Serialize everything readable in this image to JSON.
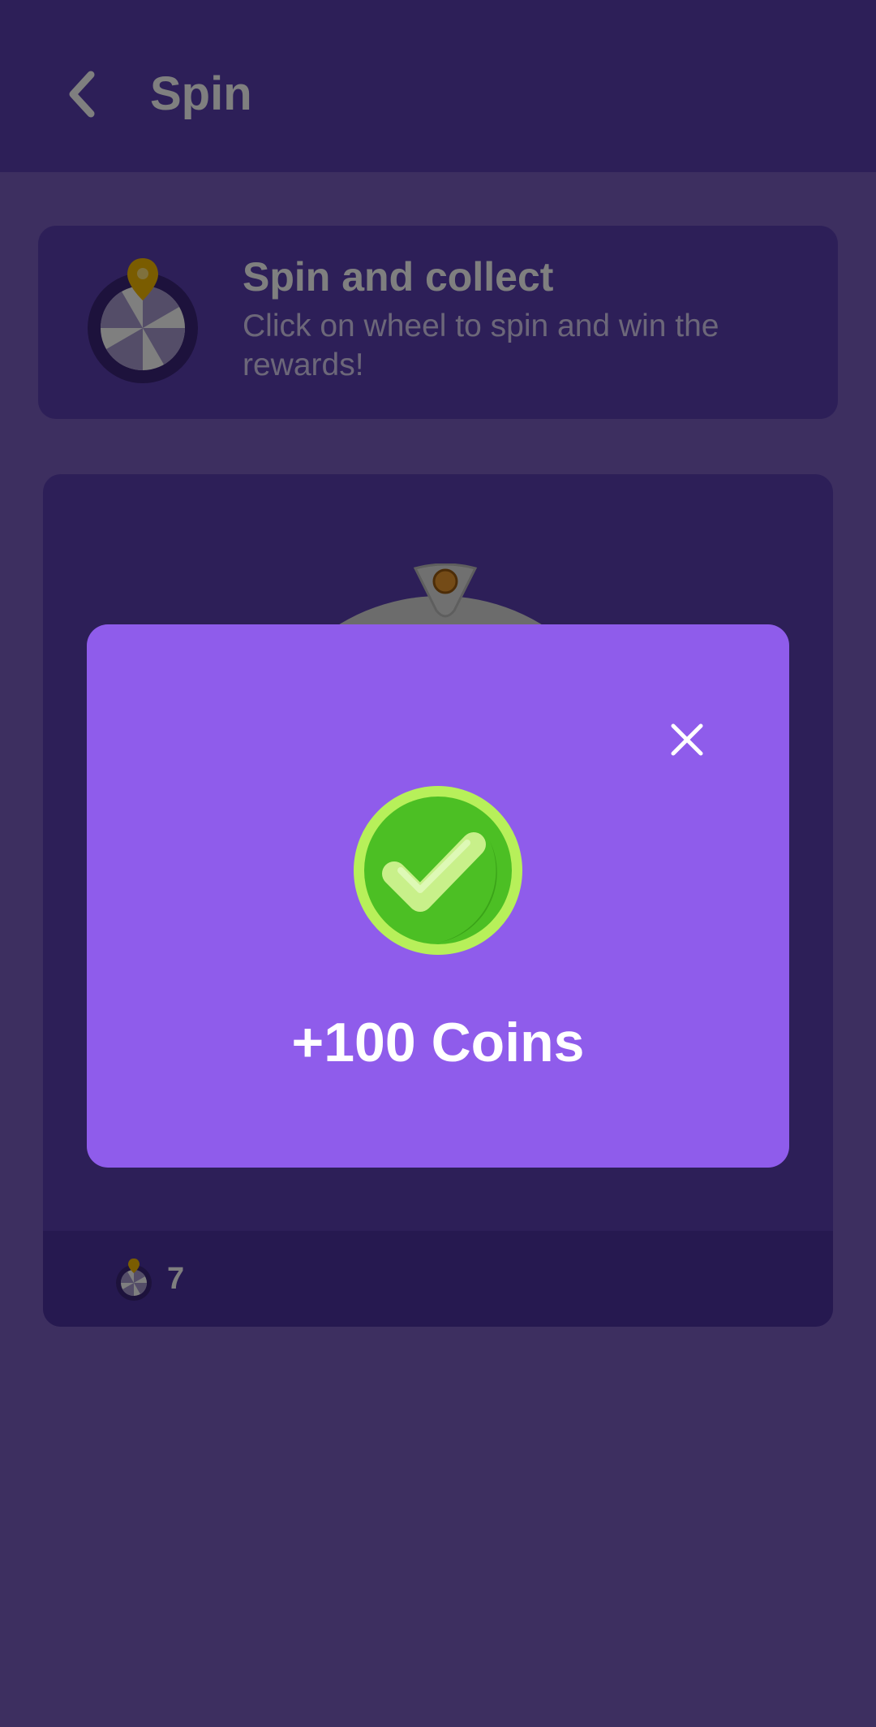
{
  "app_bar": {
    "title": "Spin",
    "back_icon": "chevron-left-icon"
  },
  "info_card": {
    "icon": "spin-wheel-icon",
    "title": "Spin and collect",
    "description": "Click on wheel to spin and win the rewards!"
  },
  "wheel": {
    "icon": "prize-wheel-icon",
    "spins_icon": "spin-wheel-icon",
    "spins_left": "7"
  },
  "dialog": {
    "close_icon": "close-icon",
    "status_icon": "success-check-icon",
    "reward_text": "+100 Coins"
  },
  "colors": {
    "appbar": "#5b3fb0",
    "background": "#7b5fc0",
    "dialog": "#8f5ceb",
    "success_green": "#4cbf24",
    "success_ring": "#b7f05a"
  }
}
